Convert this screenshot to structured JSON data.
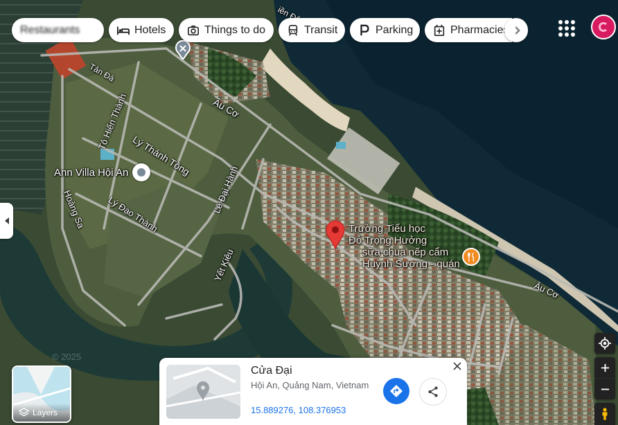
{
  "categories": [
    {
      "id": "restaurants",
      "label": "Restaurants"
    },
    {
      "id": "hotels",
      "label": "Hotels"
    },
    {
      "id": "things",
      "label": "Things to do"
    },
    {
      "id": "transit",
      "label": "Transit"
    },
    {
      "id": "parking",
      "label": "Parking"
    },
    {
      "id": "pharmacies",
      "label": "Pharmacies"
    }
  ],
  "streets": {
    "tan_da": "Tản Đà",
    "au_co_1": "Âu Cơ",
    "au_co_2": "Âu Cơ",
    "to_hien_thanh": "Tô Hiến Thành",
    "ly_thanh_tong": "Lý Thánh Tông",
    "le_dai_hanh": "Lê Đại Hành",
    "ly_dao_thanh": "Lý Đạo Thành",
    "hoang_sa": "Hoàng Sa",
    "yet_kieu": "Yết Kiêu",
    "ven_dong": "iền Đông"
  },
  "places": {
    "ann_villa": "Ann Villa Hội An",
    "school_line1": "Trường Tiểu học",
    "school_line2": "Đỗ Trọng Hưởng",
    "food_line1": "sữa chua nếp cẩm",
    "food_line2": "Huỳnh Sương - quán"
  },
  "watermark": "© 2025",
  "place_card": {
    "title": "Cửa Đại",
    "address": "Hội An, Quảng Nam, Vietnam",
    "coordinates": "15.889276, 108.376953"
  },
  "layers_label": "Layers",
  "colors": {
    "pin": "#e53935",
    "food_pin": "#f28b22",
    "directions": "#1a73e8",
    "avatar": "#d81b60",
    "link": "#1a0dab"
  },
  "icons": [
    "apps-icon",
    "avatar-icon",
    "my-location-icon",
    "zoom-in-icon",
    "zoom-out-icon",
    "pegman-icon",
    "directions-icon",
    "share-icon",
    "close-icon",
    "layers-icon",
    "chevron-left-icon"
  ]
}
